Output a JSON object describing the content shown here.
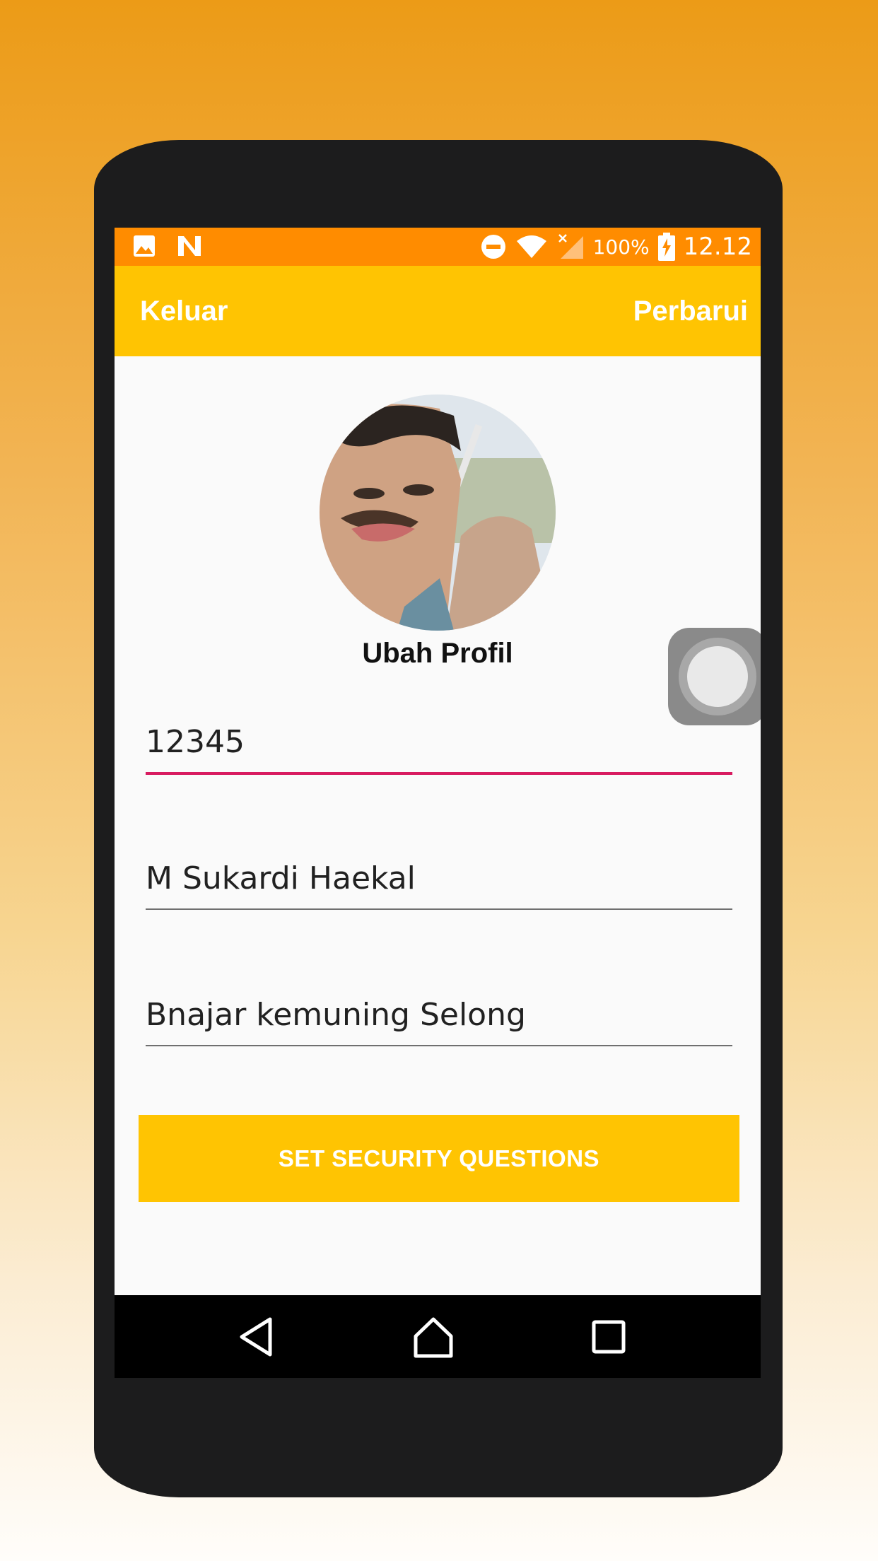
{
  "status_bar": {
    "icons": [
      "image-icon",
      "n-icon",
      "do-not-disturb-icon",
      "wifi-icon",
      "no-signal-icon",
      "battery-charging-icon"
    ],
    "battery": "100%",
    "time": "12.12"
  },
  "app_bar": {
    "logout_label": "Keluar",
    "update_label": "Perbarui"
  },
  "profile": {
    "title": "Ubah Profil"
  },
  "form": {
    "id_value": "12345",
    "name_value": "M Sukardi Haekal",
    "address_value": "Bnajar kemuning Selong"
  },
  "security_button_label": "SET SECURITY QUESTIONS",
  "colors": {
    "status_bar": "#ff8c00",
    "app_bar": "#ffc402",
    "focus_underline": "#d81b60",
    "button": "#ffc402"
  }
}
